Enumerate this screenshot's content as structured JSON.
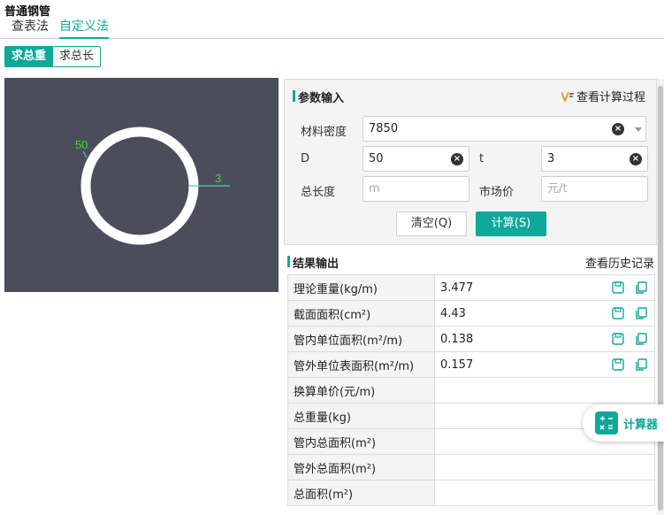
{
  "page": {
    "title": "普通钢管"
  },
  "tabs": [
    {
      "label": "查表法"
    },
    {
      "label": "自定义法"
    }
  ],
  "mode": [
    {
      "label": "求总重"
    },
    {
      "label": "求总长"
    }
  ],
  "figure": {
    "outer_label": "50",
    "thickness_label": "3",
    "label_color": "#33dd33",
    "ring_color": "#ffffff",
    "line_color": "#3ecfcf"
  },
  "params": {
    "title": "参数输入",
    "view_process": "查看计算过程",
    "density": {
      "label": "材料密度",
      "value": "7850"
    },
    "D": {
      "label": "D",
      "value": "50"
    },
    "t": {
      "label": "t",
      "value": "3"
    },
    "length": {
      "label": "总长度",
      "placeholder": "m"
    },
    "price": {
      "label": "市场价",
      "placeholder": "元/t"
    },
    "clear_button": "清空(Q)",
    "calc_button": "计算(S)"
  },
  "results": {
    "title": "结果输出",
    "history": "查看历史记录",
    "rows": [
      {
        "label": "理论重量(kg/m)",
        "value": "3.477"
      },
      {
        "label": "截面面积(cm²)",
        "value": "4.43"
      },
      {
        "label": "管内单位面积(m²/m)",
        "value": "0.138"
      },
      {
        "label": "管外单位表面积(m²/m)",
        "value": "0.157"
      },
      {
        "label": "换算单价(元/m)",
        "value": ""
      },
      {
        "label": "总重量(kg)",
        "value": ""
      },
      {
        "label": "管内总面积(m²)",
        "value": ""
      },
      {
        "label": "管外总面积(m²)",
        "value": ""
      },
      {
        "label": "总面积(m²)",
        "value": ""
      }
    ]
  },
  "floating": {
    "label": "计算器"
  },
  "colors": {
    "accent": "#0fa89a",
    "canvas_bg": "#4b4e5a"
  }
}
